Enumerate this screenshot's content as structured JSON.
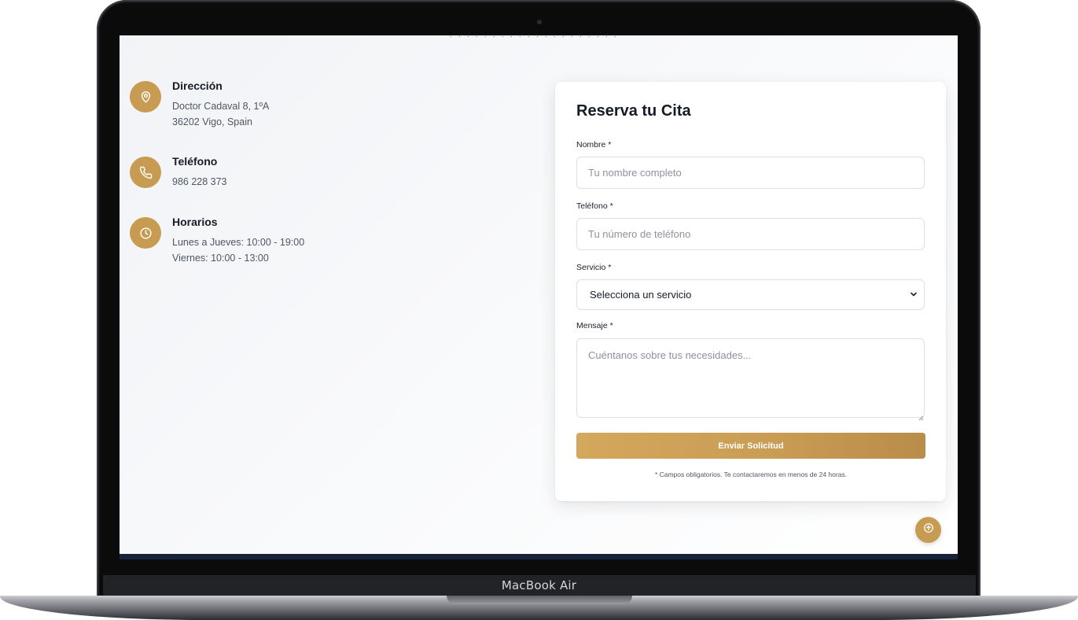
{
  "device": {
    "label": "MacBook Air"
  },
  "contact": {
    "address": {
      "icon": "map-pin-icon",
      "title": "Dirección",
      "lines": [
        "Doctor Cadaval 8, 1ºA",
        "36202 Vigo, Spain"
      ]
    },
    "phone": {
      "icon": "phone-icon",
      "title": "Teléfono",
      "lines": [
        "986 228 373"
      ]
    },
    "hours": {
      "icon": "clock-icon",
      "title": "Horarios",
      "lines": [
        "Lunes a Jueves: 10:00 - 19:00",
        "Viernes: 10:00 - 13:00"
      ]
    }
  },
  "form": {
    "title": "Reserva tu Cita",
    "name": {
      "label": "Nombre *",
      "placeholder": "Tu nombre completo",
      "value": ""
    },
    "phone": {
      "label": "Teléfono *",
      "placeholder": "Tu número de teléfono",
      "value": ""
    },
    "service": {
      "label": "Servicio *",
      "selected": "Selecciona un servicio"
    },
    "message": {
      "label": "Mensaje *",
      "placeholder": "Cuéntanos sobre tus necesidades...",
      "value": ""
    },
    "submit_label": "Enviar Solicitud",
    "note": "* Campos obligatorios. Te contactaremos en menos de 24 horas."
  },
  "colors": {
    "accent": "#c79c52",
    "button_gradient_start": "#d3a85d",
    "button_gradient_end": "#b98d4a",
    "text_dark": "#161b26",
    "footer": "#17233a"
  },
  "scroll_to_top": {
    "icon": "arrow-up-circle-icon"
  }
}
